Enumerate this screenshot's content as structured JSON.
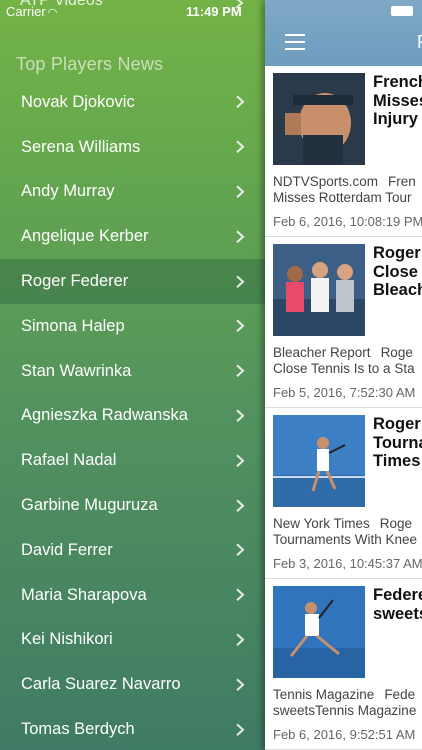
{
  "status_bar": {
    "carrier": "Carrier",
    "wifi_icon": "wifi-icon",
    "time": "11:49 PM"
  },
  "menu": {
    "partial_item": "ATP Videos",
    "section_title": "Top Players News",
    "selected_index": 4,
    "players": [
      "Novak Djokovic",
      "Serena Williams",
      "Andy Murray",
      "Angelique Kerber",
      "Roger Federer",
      "Simona Halep",
      "Stan Wawrinka",
      "Agnieszka Radwanska",
      "Rafael Nadal",
      "Garbine Muguruza",
      "David Ferrer",
      "Maria Sharapova",
      "Kei Nishikori",
      "Carla Suarez Navarro",
      "Tomas Berdych"
    ]
  },
  "navbar": {
    "menu_icon": "hamburger-icon",
    "title_partial": "R",
    "color": "#739fc1"
  },
  "articles": [
    {
      "headline_lines": [
        "French",
        "Misses",
        "Injury -"
      ],
      "source": "NDTVSports.com",
      "summary_line1": "Fren",
      "summary_line2": "Misses Rotterdam Tour",
      "date": "Feb 6, 2016, 10:08:19 PM"
    },
    {
      "headline_lines": [
        "Roger F",
        "Close T",
        "Bleach"
      ],
      "source": "Bleacher Report",
      "summary_line1": "Roge",
      "summary_line2": "Close Tennis Is to a Sta",
      "date": "Feb 5, 2016, 7:52:30 AM"
    },
    {
      "headline_lines": [
        "Roger F",
        "Tourna",
        "Times"
      ],
      "source": "New York Times",
      "summary_line1": "Roge",
      "summary_line2": "Tournaments With Knee",
      "date": "Feb 3, 2016, 10:45:37 AM"
    },
    {
      "headline_lines": [
        "Federe",
        "sweets"
      ],
      "source": "Tennis Magazine",
      "summary_line1": "Fede",
      "summary_line2": "sweetsTennis Magazine",
      "date": "Feb 6, 2016, 9:52:51 AM"
    }
  ],
  "colors": {
    "menu_top": "#74b347",
    "menu_bottom": "#3f7b64",
    "selected_row": "#4f8a62"
  }
}
